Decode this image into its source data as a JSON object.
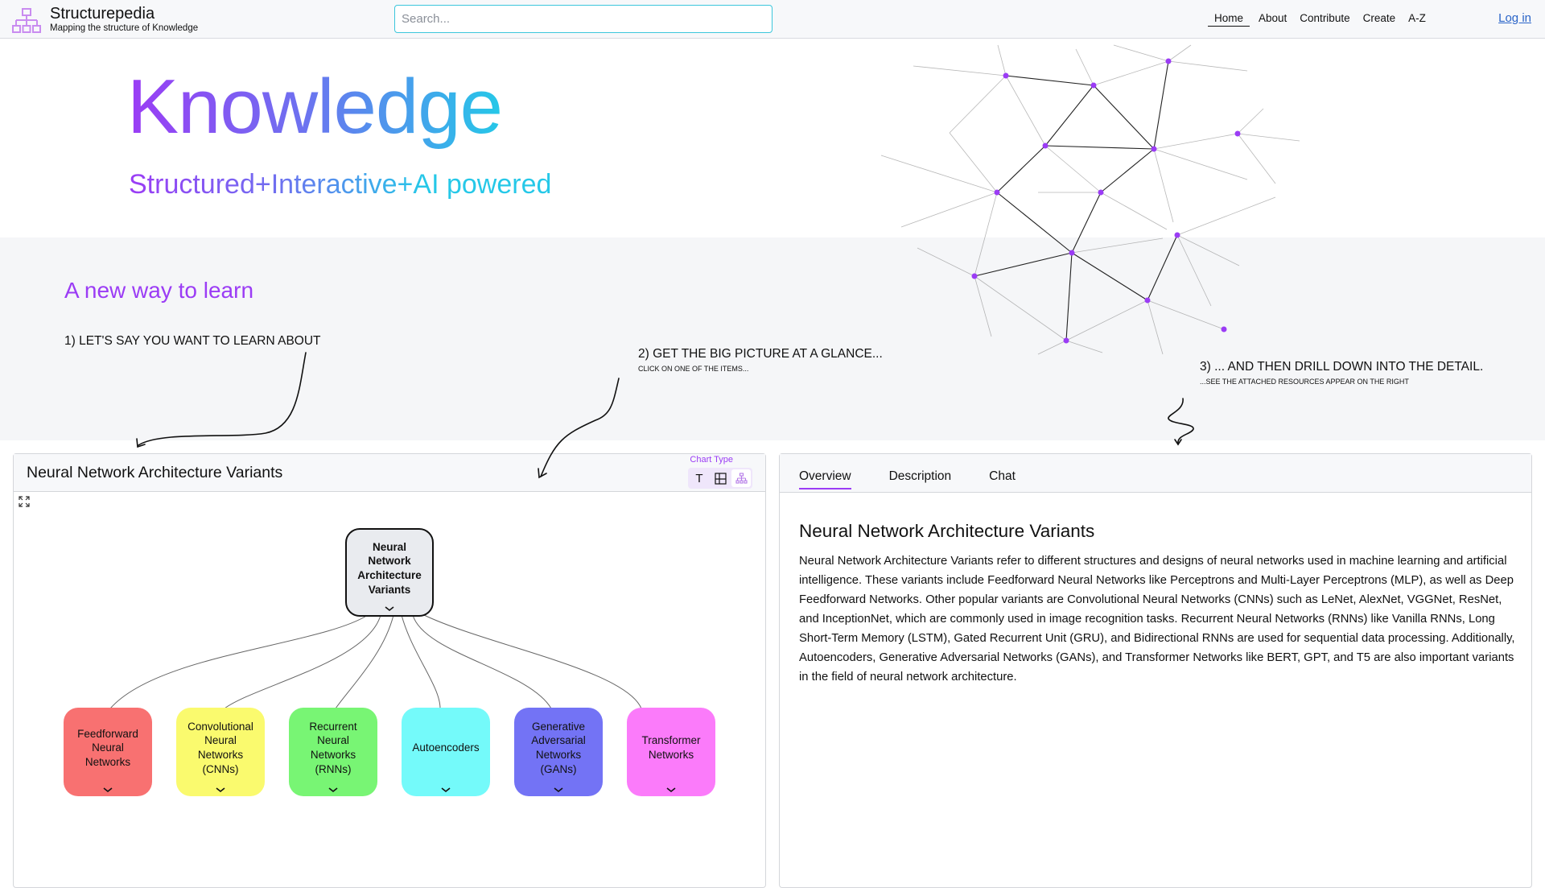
{
  "header": {
    "brand_title": "Structurepedia",
    "brand_subtitle": "Mapping the structure of Knowledge",
    "search_placeholder": "Search...",
    "search_value": "",
    "nav": [
      {
        "label": "Home",
        "active": true
      },
      {
        "label": "About",
        "active": false
      },
      {
        "label": "Contribute",
        "active": false
      },
      {
        "label": "Create",
        "active": false
      },
      {
        "label": "A-Z",
        "active": false
      }
    ],
    "login_label": "Log in"
  },
  "hero": {
    "title": "Knowledge",
    "subtitle": "Structured+Interactive+AI powered"
  },
  "intro": {
    "heading": "A new way to learn",
    "step1": "1) LET'S SAY YOU WANT TO LEARN ABOUT",
    "step2": "2) GET THE BIG PICTURE AT A GLANCE...",
    "step2_sub": "CLICK ON ONE OF THE ITEMS...",
    "step3": "3) ... AND THEN DRILL DOWN INTO THE DETAIL.",
    "step3_sub": "...SEE THE ATTACHED RESOURCES APPEAR ON THE RIGHT"
  },
  "structure_panel": {
    "title": "Neural Network Architecture Variants",
    "chart_type_label": "Chart Type",
    "chart_types": [
      {
        "name": "text",
        "glyph": "T",
        "active": false
      },
      {
        "name": "treemap",
        "active": false
      },
      {
        "name": "hierarchy",
        "active": true
      }
    ],
    "root": {
      "label": "Neural Network Architecture Variants"
    },
    "children": [
      {
        "label": "Feedforward Neural Networks",
        "color": "#f87171"
      },
      {
        "label": "Convolutional Neural Networks (CNNs)",
        "color": "#fafa6e"
      },
      {
        "label": "Recurrent Neural Networks (RNNs)",
        "color": "#78f574"
      },
      {
        "label": "Autoencoders",
        "color": "#74fafa"
      },
      {
        "label": "Generative Adversarial Networks (GANs)",
        "color": "#7373f5"
      },
      {
        "label": "Transformer Networks",
        "color": "#fb7bfa"
      }
    ]
  },
  "detail_panel": {
    "tabs": [
      {
        "label": "Overview",
        "active": true
      },
      {
        "label": "Description",
        "active": false
      },
      {
        "label": "Chat",
        "active": false
      }
    ],
    "title": "Neural Network Architecture Variants",
    "body": "Neural Network Architecture Variants refer to different structures and designs of neural networks used in machine learning and artificial intelligence. These variants include Feedforward Neural Networks like Perceptrons and Multi-Layer Perceptrons (MLP), as well as Deep Feedforward Networks. Other popular variants are Convolutional Neural Networks (CNNs) such as LeNet, AlexNet, VGGNet, ResNet, and InceptionNet, which are commonly used in image recognition tasks. Recurrent Neural Networks (RNNs) like Vanilla RNNs, Long Short-Term Memory (LSTM), Gated Recurrent Unit (GRU), and Bidirectional RNNs are used for sequential data processing. Additionally, Autoencoders, Generative Adversarial Networks (GANs), and Transformer Networks like BERT, GPT, and T5 are also important variants in the field of neural network architecture."
  },
  "colors": {
    "accent": "#9b3cf5",
    "gradient_end": "#25c8e8",
    "link": "#2a64c8",
    "search_border": "#3cc6dc"
  }
}
